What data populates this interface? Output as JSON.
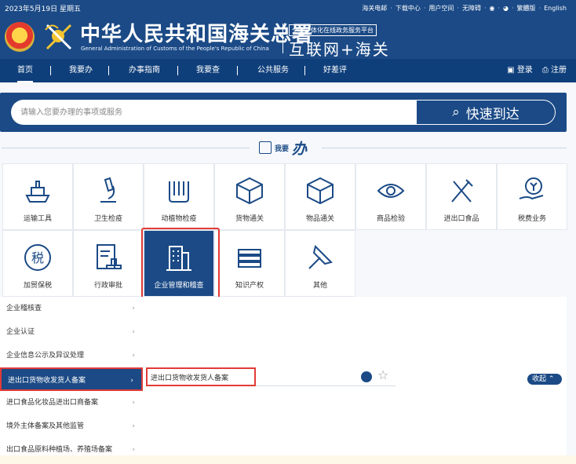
{
  "header": {
    "date": "2023年5月19日 星期五",
    "links": [
      "海关电邮",
      "下载中心",
      "用户空间",
      "无障碍",
      "",
      "",
      "繁體版",
      "English"
    ],
    "title_cn": "中华人民共和国海关总署",
    "title_en": "General Administration of Customs of the People's Republic of China",
    "platform_top": "全国一体化在线政务服务平台",
    "platform_main": "互联网+海关"
  },
  "nav": {
    "items": [
      "首页",
      "我要办",
      "办事指南",
      "我要查",
      "公共服务",
      "好差评"
    ],
    "login": "登录",
    "register": "注册"
  },
  "search": {
    "placeholder": "请输入您要办理的事项或服务",
    "button": "快速到达"
  },
  "section": {
    "title_prefix": "我要",
    "title_main": "办"
  },
  "categories": [
    "运输工具",
    "卫生检疫",
    "动植物检疫",
    "货物通关",
    "物品通关",
    "商品检验",
    "进出口食品",
    "税费业务",
    "加贸保税",
    "行政审批",
    "企业管理和稽查",
    "知识产权",
    "其他"
  ],
  "side_items": [
    "企业稽核查",
    "企业认证",
    "企业信息公示及异议处理",
    "进出口货物收发货人备案",
    "进口食品化妆品进出口商备案",
    "境外主体备案及其他监管",
    "出口食品原料种植场、养殖场备案"
  ],
  "content": {
    "item": "进出口货物收发货人备案",
    "collapse": "收起"
  },
  "colors": {
    "brand": "#1b4a86",
    "highlight": "#e23b37"
  }
}
